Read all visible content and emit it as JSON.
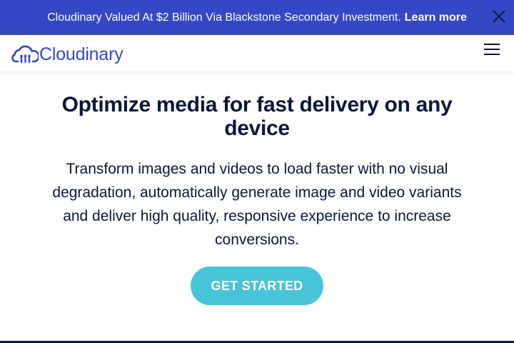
{
  "banner": {
    "message": "Cloudinary Valued At $2 Billion Via Blackstone Secondary Investment.",
    "link_label": "Learn more",
    "close_icon": "close-icon"
  },
  "header": {
    "logo_text": "Cloudinary",
    "logo_icon": "cloud-logo-icon",
    "menu_icon": "hamburger-menu-icon"
  },
  "hero": {
    "title": "Optimize media for fast delivery on any device",
    "description": "Transform images and videos to load faster with no visual degradation, automatically generate image and video variants and deliver high quality, responsive experience to increase conversions.",
    "cta_label": "GET STARTED"
  },
  "colors": {
    "banner_bg": "#3448c5",
    "brand_blue": "#3448c5",
    "heading_text": "#0c163b",
    "cta_bg": "#48c4d8"
  }
}
